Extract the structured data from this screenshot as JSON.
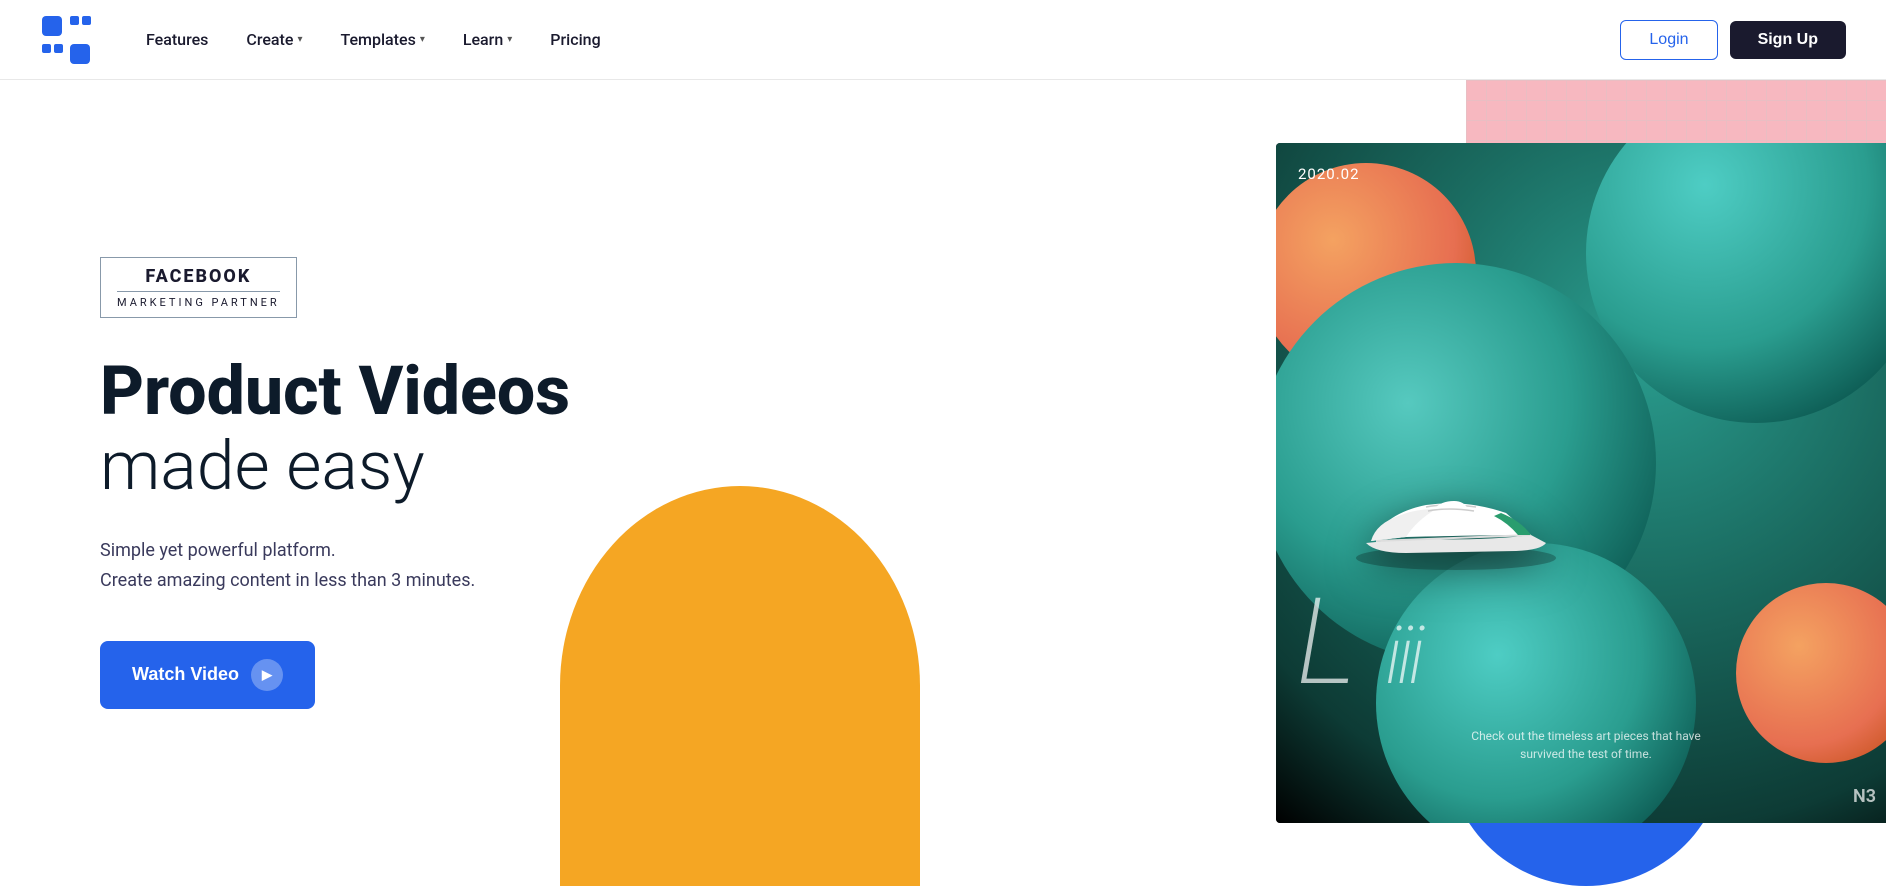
{
  "nav": {
    "logo_alt": "Promo.com Logo",
    "links": [
      {
        "label": "Features",
        "has_dropdown": false
      },
      {
        "label": "Create",
        "has_dropdown": true
      },
      {
        "label": "Templates",
        "has_dropdown": true
      },
      {
        "label": "Learn",
        "has_dropdown": true
      },
      {
        "label": "Pricing",
        "has_dropdown": false
      }
    ],
    "login_label": "Login",
    "signup_label": "Sign Up"
  },
  "hero": {
    "badge_top": "FACEBOOK",
    "badge_bottom": "MARKETING PARTNER",
    "title_bold": "Product Videos",
    "title_light": "made easy",
    "subtitle_line1": "Simple yet powerful platform.",
    "subtitle_line2": "Create amazing content in less than 3 minutes.",
    "cta_label": "Watch Video"
  },
  "video_card": {
    "date": "2020.02",
    "big_letter": "L",
    "subtitle": "Check out the timeless art pieces that have\nsurvived the test of time.",
    "badge": "N3"
  }
}
